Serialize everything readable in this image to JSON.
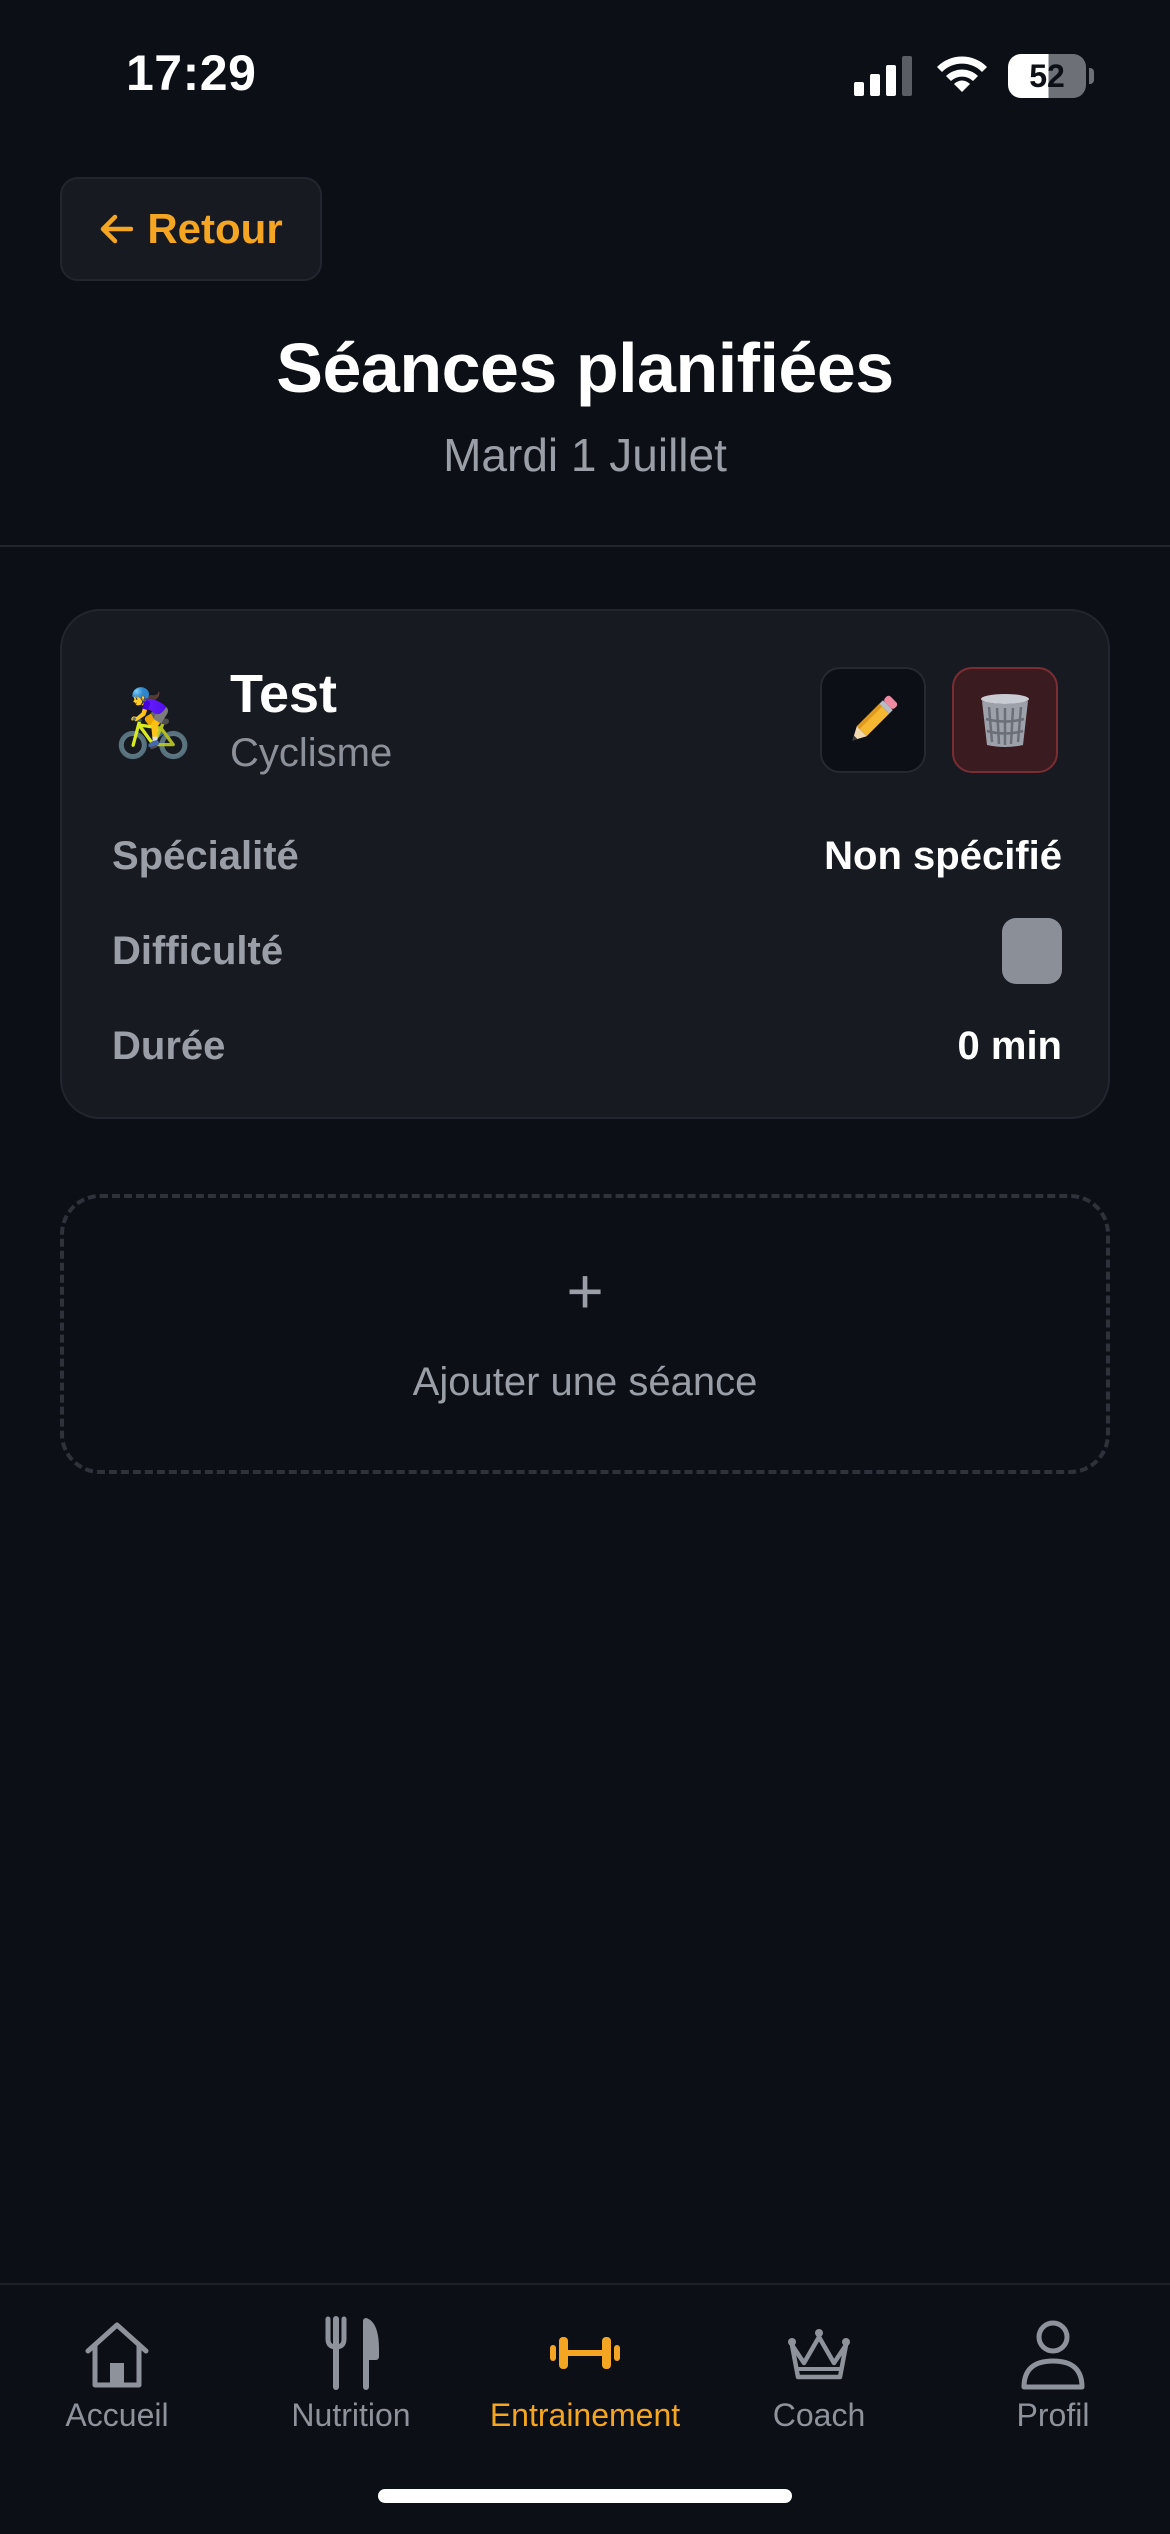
{
  "status_bar": {
    "time": "17:29",
    "battery": "52",
    "battery_level": 0.52,
    "icons": [
      "signal-icon",
      "wifi-icon",
      "battery-icon"
    ]
  },
  "header": {
    "back_label": "Retour",
    "title": "Séances planifiées",
    "date": "Mardi 1 Juillet"
  },
  "session": {
    "emoji": "🚴‍♀️",
    "name": "Test",
    "type": "Cyclisme",
    "rows": {
      "specialite_label": "Spécialité",
      "specialite_value": "Non spécifié",
      "difficulte_label": "Difficulté",
      "duree_label": "Durée",
      "duree_value": "0 min"
    },
    "actions": [
      "pencil-icon",
      "trash-icon"
    ]
  },
  "add_session": {
    "plus": "+",
    "label": "Ajouter une séance"
  },
  "nav": {
    "items": [
      {
        "label": "Accueil",
        "icon": "home-icon",
        "active": false
      },
      {
        "label": "Nutrition",
        "icon": "fork-knife-icon",
        "active": false
      },
      {
        "label": "Entrainement",
        "icon": "dumbbell-icon",
        "active": true
      },
      {
        "label": "Coach",
        "icon": "crown-icon",
        "active": false
      },
      {
        "label": "Profil",
        "icon": "user-icon",
        "active": false
      }
    ]
  },
  "colors": {
    "background": "#0c0f16",
    "card": "#171a21",
    "accent": "#f4a623",
    "muted": "#9a9ea6",
    "danger_bg": "#3a1c20"
  }
}
